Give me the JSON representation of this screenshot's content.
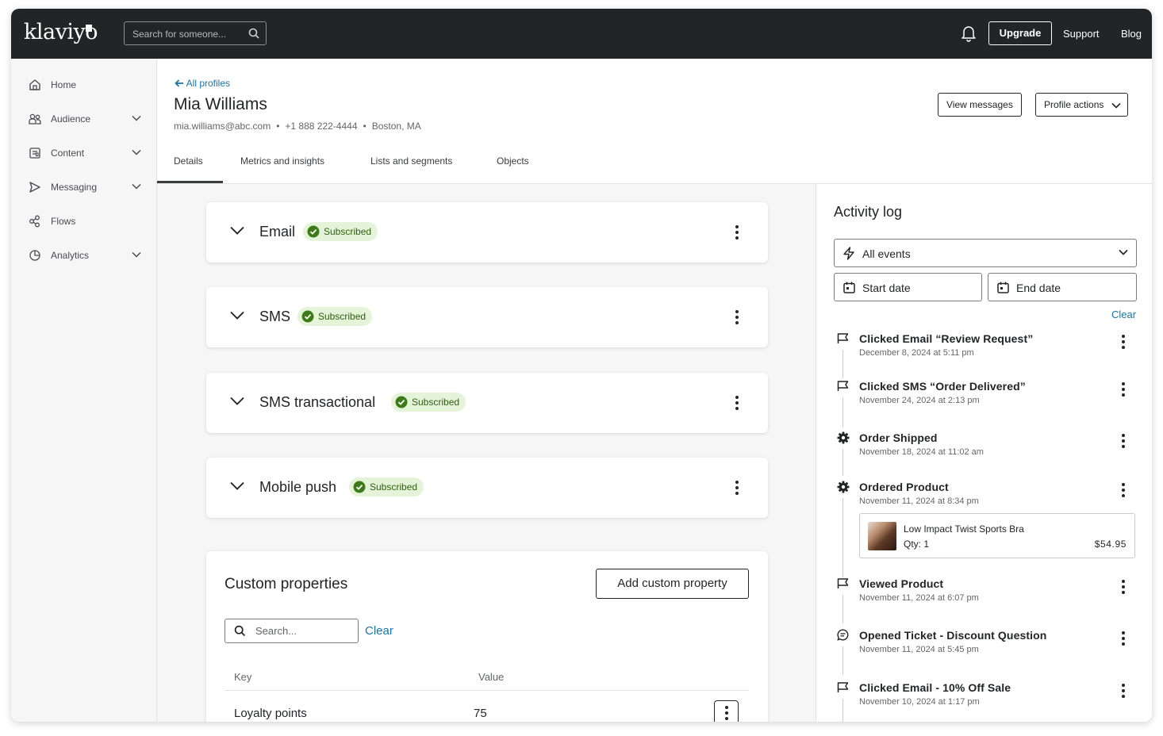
{
  "brand": {
    "logo_text": "klaviyo"
  },
  "topbar": {
    "search_placeholder": "Search for someone...",
    "upgrade_label": "Upgrade",
    "support_label": "Support",
    "blog_label": "Blog"
  },
  "sidebar": {
    "items": [
      {
        "label": "Home",
        "icon": "home-icon",
        "expandable": false
      },
      {
        "label": "Audience",
        "icon": "audience-icon",
        "expandable": true
      },
      {
        "label": "Content",
        "icon": "content-icon",
        "expandable": true
      },
      {
        "label": "Messaging",
        "icon": "send-icon",
        "expandable": true
      },
      {
        "label": "Flows",
        "icon": "flows-icon",
        "expandable": false
      },
      {
        "label": "Analytics",
        "icon": "analytics-icon",
        "expandable": true
      }
    ]
  },
  "profile": {
    "back_label": "All profiles",
    "name": "Mia Williams",
    "email": "mia.williams@abc.com",
    "phone": "+1 888 222-4444",
    "location": "Boston, MA",
    "view_messages_label": "View messages",
    "profile_actions_label": "Profile actions"
  },
  "tabs": [
    {
      "label": "Details",
      "active": true
    },
    {
      "label": "Metrics and insights",
      "active": false
    },
    {
      "label": "Lists and segments",
      "active": false
    },
    {
      "label": "Objects",
      "active": false
    }
  ],
  "channels": [
    {
      "name": "Email",
      "status": "Subscribed"
    },
    {
      "name": "SMS",
      "status": "Subscribed"
    },
    {
      "name": "SMS transactional",
      "status": "Subscribed"
    },
    {
      "name": "Mobile push",
      "status": "Subscribed"
    }
  ],
  "custom_properties": {
    "title": "Custom properties",
    "add_label": "Add custom property",
    "search_placeholder": "Search...",
    "clear_label": "Clear",
    "columns": {
      "key": "Key",
      "value": "Value"
    },
    "rows": [
      {
        "key": "Loyalty points",
        "value": "75"
      }
    ]
  },
  "activity_log": {
    "title": "Activity log",
    "filter_label": "All events",
    "start_date_label": "Start date",
    "end_date_label": "End date",
    "clear_label": "Clear",
    "events": [
      {
        "title": "Clicked Email “Review Request”",
        "date": "December 8, 2024 at 5:11 pm",
        "icon": "flag-icon"
      },
      {
        "title": "Clicked SMS “Order Delivered”",
        "date": "November 24, 2024 at 2:13 pm",
        "icon": "flag-icon"
      },
      {
        "title": "Order Shipped",
        "date": "November 18, 2024 at 11:02 am",
        "icon": "gear-icon"
      },
      {
        "title": "Ordered Product",
        "date": "November 11, 2024 at 8:34 pm",
        "icon": "gear-icon",
        "product": {
          "name": "Low Impact Twist Sports Bra",
          "qty": "Qty: 1",
          "price": "$54.95"
        }
      },
      {
        "title": "Viewed Product",
        "date": "November 11, 2024 at 6:07 pm",
        "icon": "flag-icon"
      },
      {
        "title": "Opened Ticket - Discount Question",
        "date": "November 11, 2024 at 5:45 pm",
        "icon": "chat-icon"
      },
      {
        "title": "Clicked Email - 10% Off Sale",
        "date": "November 10, 2024 at 1:17 pm",
        "icon": "flag-icon"
      }
    ]
  },
  "colors": {
    "topbar": "#232426",
    "link": "#1a73a7",
    "badge_bg": "#e5f4d9",
    "badge_text": "#2f5d11",
    "badge_check": "#3d7a18"
  }
}
